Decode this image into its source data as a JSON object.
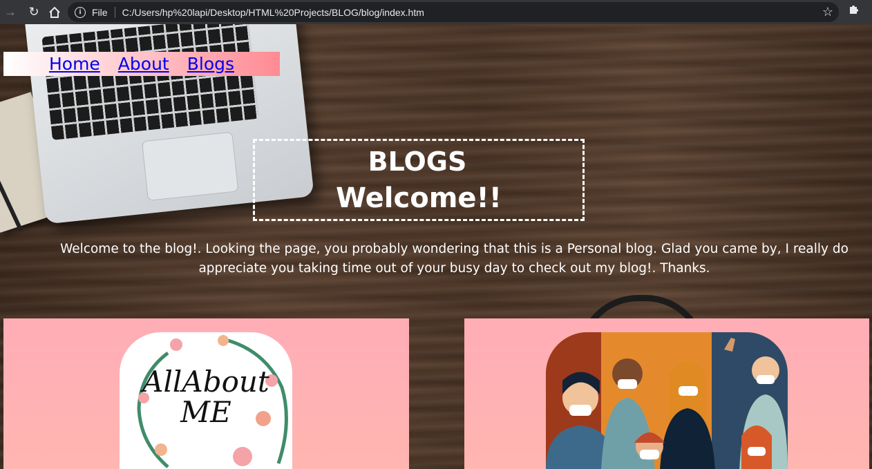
{
  "browser": {
    "scheme_label": "File",
    "url": "C:/Users/hp%20lapi/Desktop/HTML%20Projects/BLOG/blog/index.htm"
  },
  "nav": {
    "links": [
      "Home",
      "About",
      "Blogs"
    ]
  },
  "hero": {
    "title": "BLOGS",
    "subtitle": "Welcome!!"
  },
  "intro": "Welcome to the blog!. Looking the page, you probably wondering that this is a Personal blog. Glad you came by, I really do appreciate you taking time out of your busy day to check out my blog!. Thanks.",
  "cards": [
    {
      "image_text": "AllAbout ME"
    }
  ],
  "colors": {
    "card_bg": "#ffadb6",
    "nav_gradient_end": "#ff8a93",
    "link": "#0000ee"
  }
}
